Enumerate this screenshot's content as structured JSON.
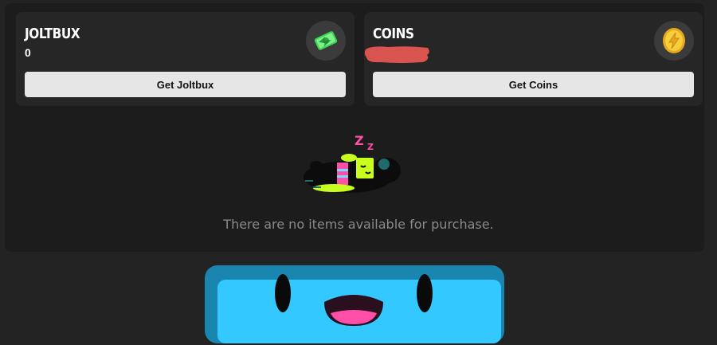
{
  "currencies": {
    "joltbux": {
      "title": "JOLTBUX",
      "balance": "0",
      "button_label": "Get Joltbux",
      "icon": "joltbux-currency-icon"
    },
    "coins": {
      "title": "COINS",
      "balance_redacted": true,
      "button_label": "Get Coins",
      "icon": "coin-currency-icon"
    }
  },
  "store": {
    "empty_message": "There are no items available for purchase.",
    "empty_illustration": "sleeping-robot-illustration"
  },
  "mascot": "blue-smiling-block-mascot",
  "colors": {
    "background": "#232323",
    "panel": "#1c1c1c",
    "card": "#262626",
    "button": "#e6e6e6",
    "redaction": "#d9534f",
    "accent_lime": "#c8ff1e",
    "accent_pink": "#ff4fa8",
    "mascot_blue": "#33c8ff"
  }
}
